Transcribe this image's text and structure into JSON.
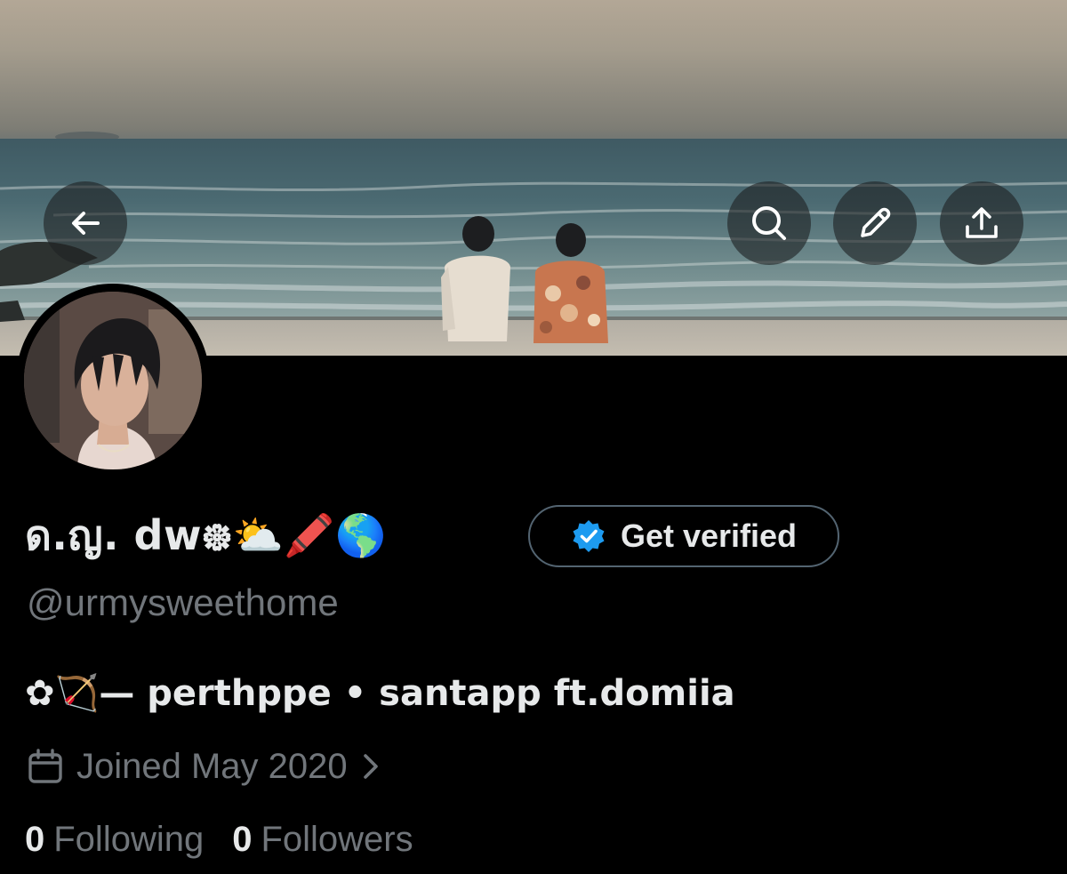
{
  "profile": {
    "display_name": "ด.ญ. dw᪥⛅🖍️🌎",
    "handle": "@urmysweethome",
    "bio": "✿🏹— perthppe • santapp ft.domiia",
    "joined": "Joined May 2020",
    "following_count": "0",
    "following_label": "Following",
    "followers_count": "0",
    "followers_label": "Followers"
  },
  "actions": {
    "get_verified_label": "Get verified"
  },
  "icons": {
    "back": "arrow-left-icon",
    "search": "search-icon",
    "edit": "pencil-icon",
    "share": "share-icon",
    "verified": "verified-badge-icon",
    "calendar": "calendar-icon",
    "chevron": "chevron-right-icon"
  },
  "colors": {
    "background": "#000000",
    "primary_text": "#e7e9ea",
    "secondary_text": "#71767b",
    "verified_blue": "#1d9bf0",
    "button_border": "#536471"
  }
}
